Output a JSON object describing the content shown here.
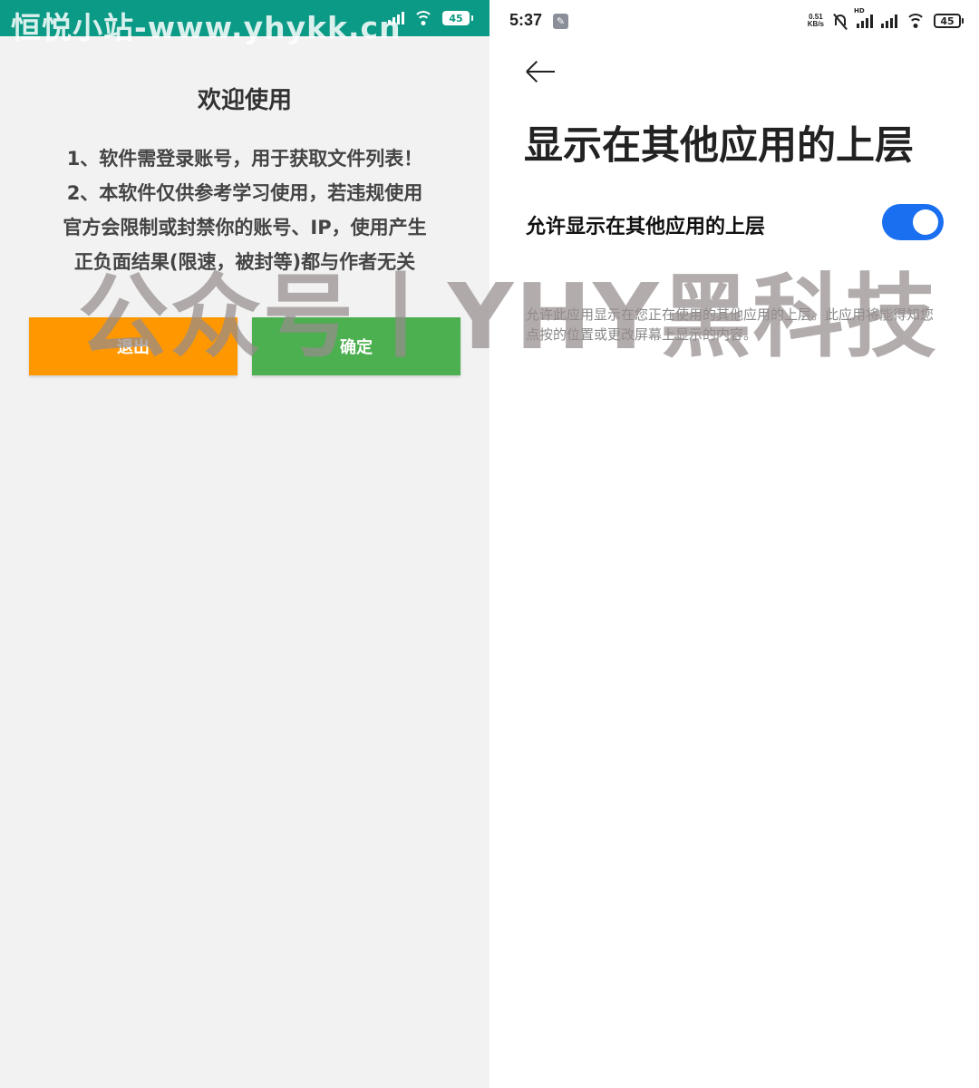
{
  "left_panel": {
    "status_bar": {
      "battery": "45"
    },
    "dialog": {
      "title": "欢迎使用",
      "lines": [
        "1、软件需登录账号，用于获取文件列表！",
        "2、本软件仅供参考学习使用，若违规使用",
        "官方会限制或封禁你的账号、IP，使用产生",
        "正负面结果(限速，被封等)都与作者无关"
      ],
      "exit_label": "退出",
      "ok_label": "确定"
    },
    "colors": {
      "status_bar": "#0b9a86",
      "exit_button": "#ff9800",
      "ok_button": "#4caf50"
    }
  },
  "right_panel": {
    "status_bar": {
      "time": "5:37",
      "net_speed_value": "0.51",
      "net_speed_unit": "KB/s",
      "network_type": "HD",
      "battery": "45"
    },
    "page_title": "显示在其他应用的上层",
    "setting_label": "允许显示在其他应用的上层",
    "toggle_on": true,
    "description": "允许此应用显示在您正在使用的其他应用的上层。此应用将能得知您点按的位置或更改屏幕上显示的内容。",
    "colors": {
      "toggle": "#1a6ff0"
    }
  },
  "watermarks": {
    "top": "恒悦小站-www.yhykk.cn",
    "center": "公众号丨YHY黑科技"
  }
}
